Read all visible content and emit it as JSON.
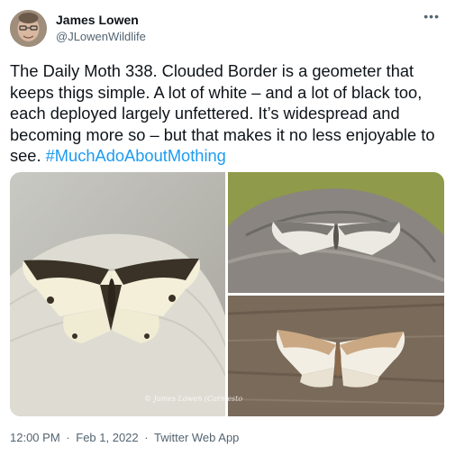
{
  "author": {
    "name": "James Lowen",
    "handle": "@JLowenWildlife",
    "avatar_icon": "profile-photo"
  },
  "more_icon": "more-horizontal-icon",
  "tweet": {
    "text_part1": "The Daily Moth 338. Clouded Border is a geometer that keeps thigs simple. A lot of white – and a lot of black too, each deployed largely unfettered. It’s widespread and becoming more so – but that makes it no less enjoyable to see. ",
    "hashtag": "#MuchAdoAboutMothing"
  },
  "media": {
    "photo1_watermark": "© James Lowen (Carmesto",
    "colors": {
      "wing_cream": "#f3efd9",
      "wing_dark": "#3a3226",
      "rock_grey": "#8a8580",
      "wood_brown": "#7a6a5a",
      "wing_tan": "#c9a883"
    }
  },
  "meta": {
    "time": "12:00 PM",
    "date": "Feb 1, 2022",
    "source": "Twitter Web App",
    "separator": "·"
  },
  "colors": {
    "accent": "#1d9bf0",
    "secondary_text": "#536471"
  }
}
